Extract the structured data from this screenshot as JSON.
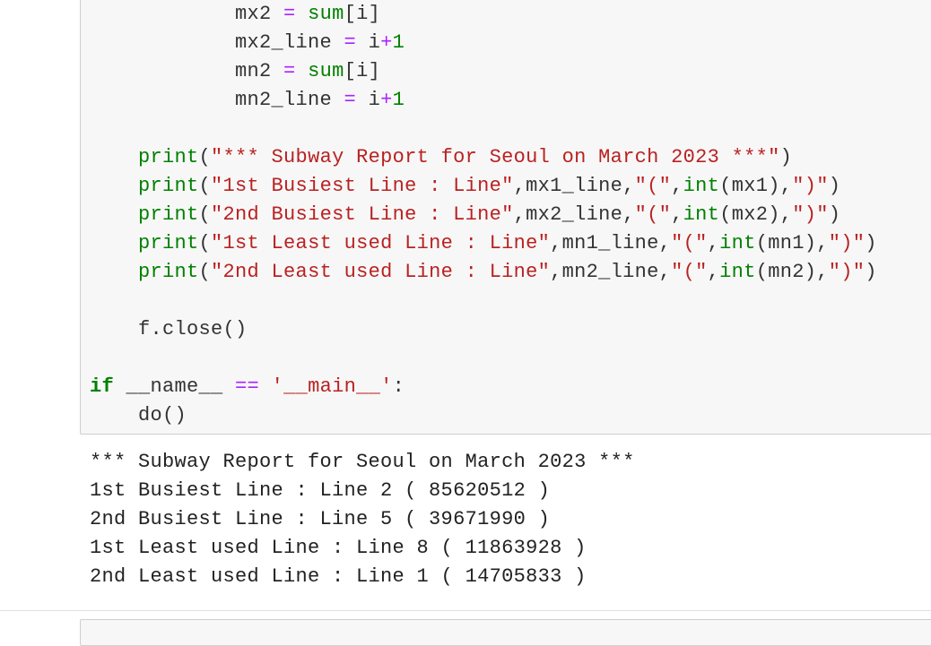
{
  "code_cell": {
    "lines": [
      [
        {
          "t": "            mx2 ",
          "c": ""
        },
        {
          "t": "=",
          "c": "op"
        },
        {
          "t": " ",
          "c": ""
        },
        {
          "t": "sum",
          "c": "bi"
        },
        {
          "t": "[i]",
          "c": ""
        }
      ],
      [
        {
          "t": "            mx2_line ",
          "c": ""
        },
        {
          "t": "=",
          "c": "op"
        },
        {
          "t": " i",
          "c": ""
        },
        {
          "t": "+",
          "c": "op"
        },
        {
          "t": "1",
          "c": "nm"
        }
      ],
      [
        {
          "t": "            mn2 ",
          "c": ""
        },
        {
          "t": "=",
          "c": "op"
        },
        {
          "t": " ",
          "c": ""
        },
        {
          "t": "sum",
          "c": "bi"
        },
        {
          "t": "[i]",
          "c": ""
        }
      ],
      [
        {
          "t": "            mn2_line ",
          "c": ""
        },
        {
          "t": "=",
          "c": "op"
        },
        {
          "t": " i",
          "c": ""
        },
        {
          "t": "+",
          "c": "op"
        },
        {
          "t": "1",
          "c": "nm"
        }
      ],
      [
        {
          "t": "",
          "c": ""
        }
      ],
      [
        {
          "t": "    ",
          "c": ""
        },
        {
          "t": "print",
          "c": "bi"
        },
        {
          "t": "(",
          "c": ""
        },
        {
          "t": "\"*** Subway Report for Seoul on March 2023 ***\"",
          "c": "st"
        },
        {
          "t": ")",
          "c": ""
        }
      ],
      [
        {
          "t": "    ",
          "c": ""
        },
        {
          "t": "print",
          "c": "bi"
        },
        {
          "t": "(",
          "c": ""
        },
        {
          "t": "\"1st Busiest Line : Line\"",
          "c": "st"
        },
        {
          "t": ",mx1_line,",
          "c": ""
        },
        {
          "t": "\"(\"",
          "c": "st"
        },
        {
          "t": ",",
          "c": ""
        },
        {
          "t": "int",
          "c": "bi"
        },
        {
          "t": "(mx1),",
          "c": ""
        },
        {
          "t": "\")\"",
          "c": "st"
        },
        {
          "t": ")",
          "c": ""
        }
      ],
      [
        {
          "t": "    ",
          "c": ""
        },
        {
          "t": "print",
          "c": "bi"
        },
        {
          "t": "(",
          "c": ""
        },
        {
          "t": "\"2nd Busiest Line : Line\"",
          "c": "st"
        },
        {
          "t": ",mx2_line,",
          "c": ""
        },
        {
          "t": "\"(\"",
          "c": "st"
        },
        {
          "t": ",",
          "c": ""
        },
        {
          "t": "int",
          "c": "bi"
        },
        {
          "t": "(mx2),",
          "c": ""
        },
        {
          "t": "\")\"",
          "c": "st"
        },
        {
          "t": ")",
          "c": ""
        }
      ],
      [
        {
          "t": "    ",
          "c": ""
        },
        {
          "t": "print",
          "c": "bi"
        },
        {
          "t": "(",
          "c": ""
        },
        {
          "t": "\"1st Least used Line : Line\"",
          "c": "st"
        },
        {
          "t": ",mn1_line,",
          "c": ""
        },
        {
          "t": "\"(\"",
          "c": "st"
        },
        {
          "t": ",",
          "c": ""
        },
        {
          "t": "int",
          "c": "bi"
        },
        {
          "t": "(mn1),",
          "c": ""
        },
        {
          "t": "\")\"",
          "c": "st"
        },
        {
          "t": ")",
          "c": ""
        }
      ],
      [
        {
          "t": "    ",
          "c": ""
        },
        {
          "t": "print",
          "c": "bi"
        },
        {
          "t": "(",
          "c": ""
        },
        {
          "t": "\"2nd Least used Line : Line\"",
          "c": "st"
        },
        {
          "t": ",mn2_line,",
          "c": ""
        },
        {
          "t": "\"(\"",
          "c": "st"
        },
        {
          "t": ",",
          "c": ""
        },
        {
          "t": "int",
          "c": "bi"
        },
        {
          "t": "(mn2),",
          "c": ""
        },
        {
          "t": "\")\"",
          "c": "st"
        },
        {
          "t": ")",
          "c": ""
        }
      ],
      [
        {
          "t": "",
          "c": ""
        }
      ],
      [
        {
          "t": "    f.close()",
          "c": ""
        }
      ],
      [
        {
          "t": "",
          "c": ""
        }
      ],
      [
        {
          "t": "if",
          "c": "kw"
        },
        {
          "t": " __name__ ",
          "c": ""
        },
        {
          "t": "==",
          "c": "op"
        },
        {
          "t": " ",
          "c": ""
        },
        {
          "t": "'__main__'",
          "c": "st"
        },
        {
          "t": ":",
          "c": ""
        }
      ],
      [
        {
          "t": "    do()",
          "c": ""
        }
      ]
    ]
  },
  "output_cell": {
    "lines": [
      "*** Subway Report for Seoul on March 2023 ***",
      "1st Busiest Line : Line 2 ( 85620512 )",
      "2nd Busiest Line : Line 5 ( 39671990 )",
      "1st Least used Line : Line 8 ( 11863928 )",
      "2nd Least used Line : Line 1 ( 14705833 )"
    ]
  },
  "colors": {
    "cell_background": "#f7f7f7",
    "cell_border": "#cfcfcf",
    "keyword": "#008000",
    "string": "#ba2121",
    "operator": "#aa22ff"
  }
}
